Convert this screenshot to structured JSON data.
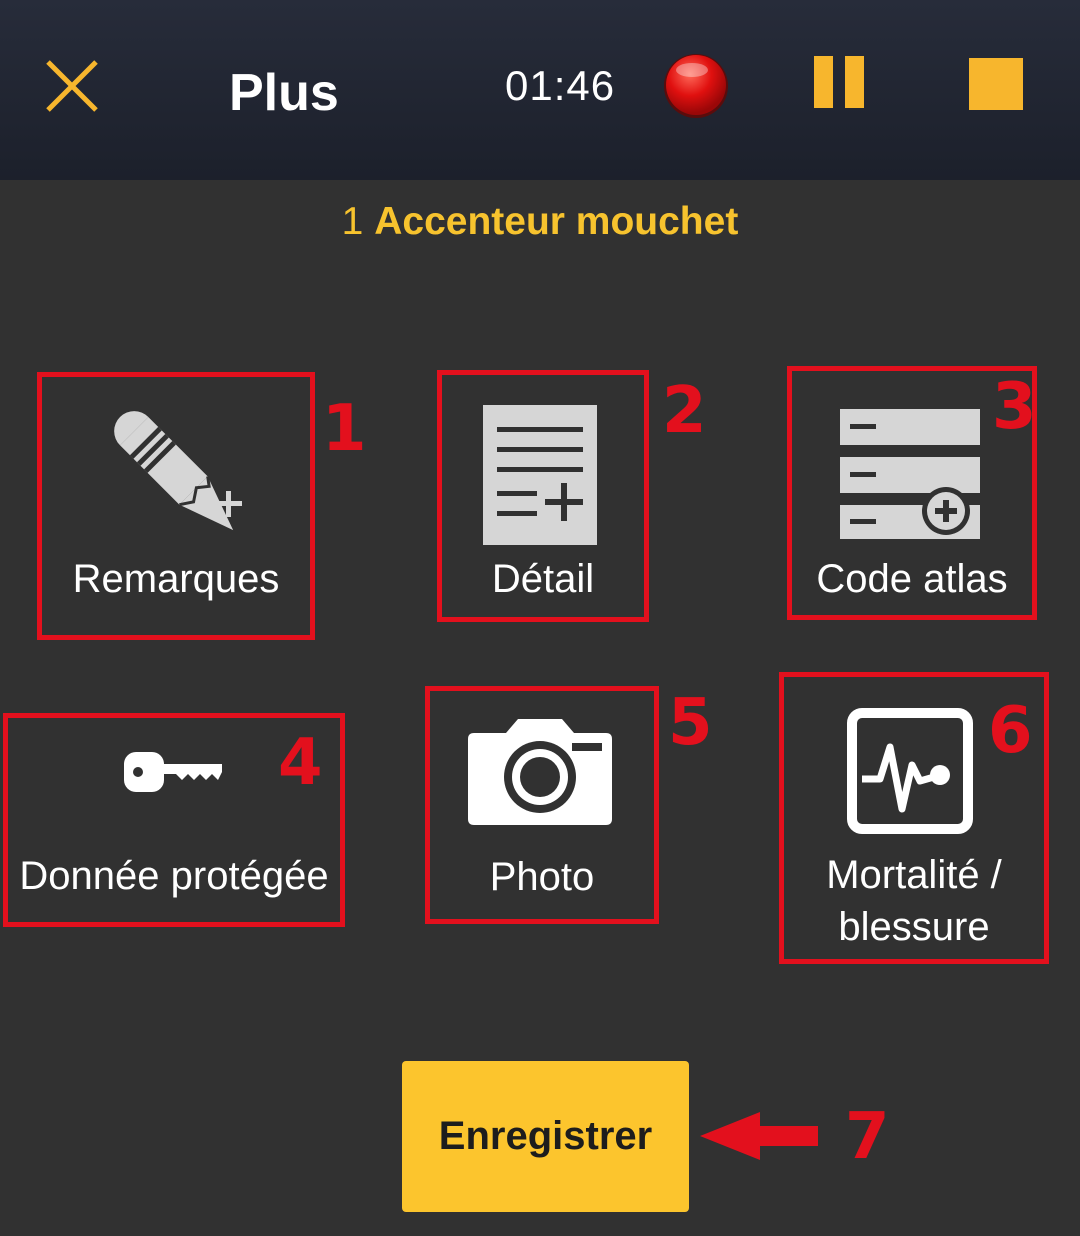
{
  "header": {
    "title": "Plus",
    "timer": "01:46",
    "close_icon": "close-icon",
    "record_icon": "record-icon",
    "pause_icon": "pause-icon",
    "stop_icon": "stop-icon",
    "accent_color": "#f7b62d"
  },
  "species": {
    "count": "1",
    "name": "Accenteur mouchet"
  },
  "tiles": [
    {
      "label": "Remarques",
      "icon": "pencil-plus-icon"
    },
    {
      "label": "Détail",
      "icon": "document-plus-icon"
    },
    {
      "label": "Code atlas",
      "icon": "stack-plus-icon"
    },
    {
      "label": "Donnée protégée",
      "icon": "key-icon"
    },
    {
      "label": "Photo",
      "icon": "camera-icon"
    },
    {
      "label_line1": "Mortalité /",
      "label_line2": "blessure",
      "icon": "pulse-monitor-icon"
    }
  ],
  "save_button": {
    "label": "Enregistrer",
    "color": "#fcc52d"
  },
  "annotations": {
    "numbers": [
      "1",
      "2",
      "3",
      "4",
      "5",
      "6",
      "7"
    ],
    "color": "#e3101d",
    "arrow_icon": "left-arrow-icon"
  }
}
